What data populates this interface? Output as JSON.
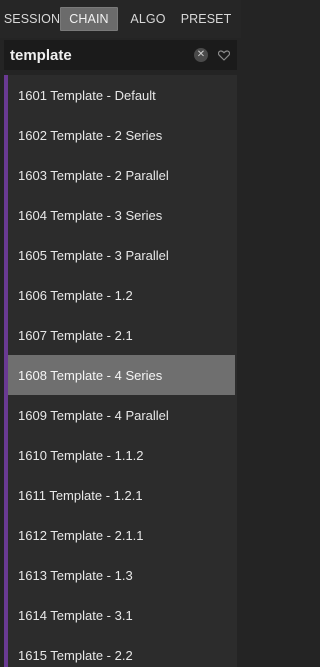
{
  "tabs": [
    {
      "label": "SESSION"
    },
    {
      "label": "CHAIN"
    },
    {
      "label": "ALGO"
    },
    {
      "label": "PRESET"
    }
  ],
  "search": {
    "value": "template",
    "clear_glyph": "✕"
  },
  "list": {
    "accent_color": "#6a3a93",
    "selected_index": 7,
    "items": [
      {
        "label": "1601 Template - Default"
      },
      {
        "label": "1602 Template - 2 Series"
      },
      {
        "label": "1603 Template - 2 Parallel"
      },
      {
        "label": "1604 Template - 3 Series"
      },
      {
        "label": "1605 Template - 3 Parallel"
      },
      {
        "label": "1606 Template - 1.2"
      },
      {
        "label": "1607 Template - 2.1"
      },
      {
        "label": "1608 Template - 4 Series"
      },
      {
        "label": "1609 Template - 4 Parallel"
      },
      {
        "label": "1610 Template - 1.1.2"
      },
      {
        "label": "1611 Template - 1.2.1"
      },
      {
        "label": "1612 Template - 2.1.1"
      },
      {
        "label": "1613 Template - 1.3"
      },
      {
        "label": "1614 Template - 3.1"
      },
      {
        "label": "1615 Template - 2.2"
      }
    ]
  }
}
